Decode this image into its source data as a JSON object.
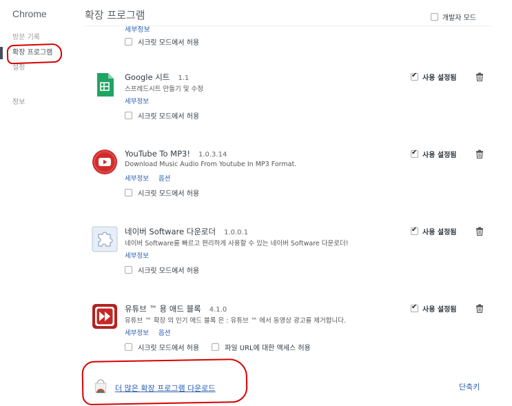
{
  "sidebar": {
    "brand": "Chrome",
    "items": [
      {
        "label": "방문 기록"
      },
      {
        "label": "확장 프로그램"
      },
      {
        "label": "설정"
      },
      {
        "label": "정보"
      }
    ]
  },
  "header": {
    "title": "확장 프로그램",
    "devmode_label": "개발자 모드"
  },
  "top_partial": {
    "link": "세부정보",
    "incognito": "시크릿 모드에서 허용"
  },
  "extensions": [
    {
      "name": "Google 시트",
      "version": "1.1",
      "description": "스프레드시트 만들기 및 수정",
      "links": [
        "세부정보"
      ],
      "incognito": "시크릿 모드에서 허용",
      "enabled_label": "사용 설정됨",
      "icon": "google-sheets-icon"
    },
    {
      "name": "YouTube To MP3!",
      "version": "1.0.3.14",
      "description": "Download Music Audio From Youtube In MP3 Format.",
      "links": [
        "세부정보",
        "옵션"
      ],
      "incognito": "시크릿 모드에서 허용",
      "enabled_label": "사용 설정됨",
      "icon": "youtube-play-icon"
    },
    {
      "name": "네이버 Software 다운로더",
      "version": "1.0.0.1",
      "description": "네이버 Software를 빠르고 편리하게 사용할 수 있는 네이버 Software 다운로더!",
      "links": [
        "세부정보"
      ],
      "incognito": "시크릿 모드에서 허용",
      "enabled_label": "사용 설정됨",
      "icon": "puzzle-piece-icon"
    },
    {
      "name": "유튜브 ™ 용 애드 블록",
      "version": "4.1.0",
      "description": "유튜브 ™ 확장 의 인기 애드 블록 은 : 유튜브 ™ 에서 동영상 광고를 제거합니다.",
      "links": [
        "세부정보",
        "옵션"
      ],
      "incognito": "시크릿 모드에서 허용",
      "file_access": "파일 URL에 대한 액세스 허용",
      "enabled_label": "사용 설정됨",
      "icon": "fast-forward-icon"
    }
  ],
  "footer": {
    "more_link": "더 많은 확장 프로그램 다운로드",
    "shortcuts": "단축키"
  },
  "colors": {
    "link": "#2a5db0",
    "annotation": "#d40000",
    "sheets_green": "#1fa463",
    "youtube_red": "#d32b2b",
    "adblock_red": "#b22222"
  }
}
